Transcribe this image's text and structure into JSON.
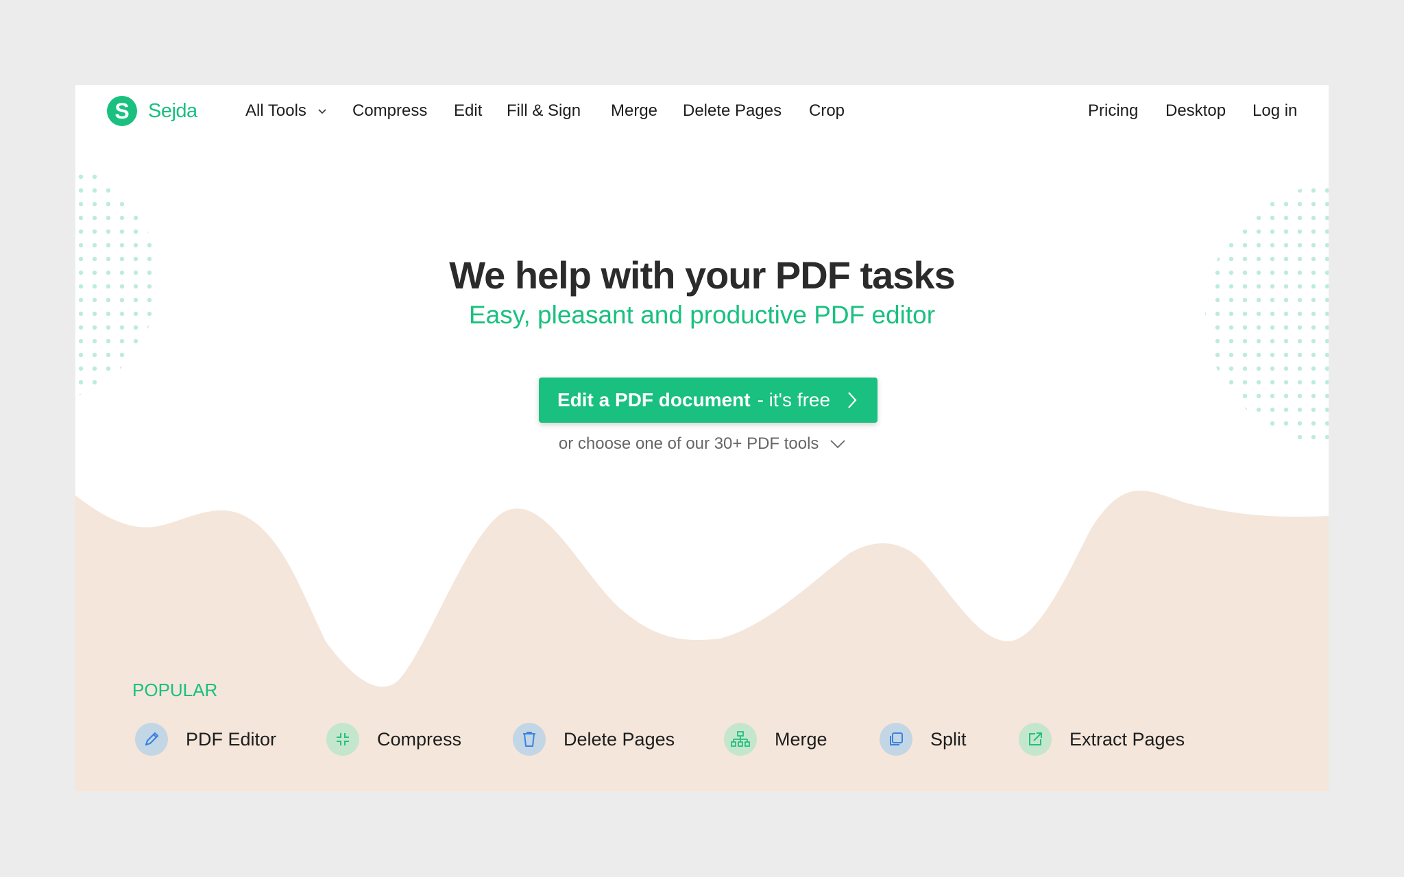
{
  "brand": {
    "logo_letter": "S",
    "name": "Sejda",
    "accent_color": "#19c07f"
  },
  "nav": {
    "left": [
      {
        "label": "All Tools",
        "has_dropdown": true
      },
      {
        "label": "Compress"
      },
      {
        "label": "Edit"
      },
      {
        "label": "Fill & Sign"
      },
      {
        "label": "Merge"
      },
      {
        "label": "Delete Pages"
      },
      {
        "label": "Crop"
      }
    ],
    "right": [
      {
        "label": "Pricing"
      },
      {
        "label": "Desktop"
      },
      {
        "label": "Log in"
      }
    ]
  },
  "hero": {
    "title": "We help with your PDF tasks",
    "subtitle": "Easy, pleasant and productive PDF editor",
    "cta_strong": "Edit a PDF document",
    "cta_light": "- it's free",
    "more_tools": "or choose one of our 30+ PDF tools"
  },
  "popular": {
    "label": "POPULAR",
    "items": [
      {
        "label": "PDF Editor",
        "icon": "pencil-icon",
        "tone": "blue"
      },
      {
        "label": "Compress",
        "icon": "compress-icon",
        "tone": "green"
      },
      {
        "label": "Delete Pages",
        "icon": "trash-icon",
        "tone": "blue"
      },
      {
        "label": "Merge",
        "icon": "merge-tree-icon",
        "tone": "green"
      },
      {
        "label": "Split",
        "icon": "split-copy-icon",
        "tone": "blue"
      },
      {
        "label": "Extract Pages",
        "icon": "extract-icon",
        "tone": "green"
      }
    ]
  },
  "colors": {
    "wave": "#f4e6da",
    "dots": "#bdebdf",
    "page_bg": "#ececec",
    "icon_blue": "#3b82e0",
    "icon_green": "#22c07e"
  }
}
